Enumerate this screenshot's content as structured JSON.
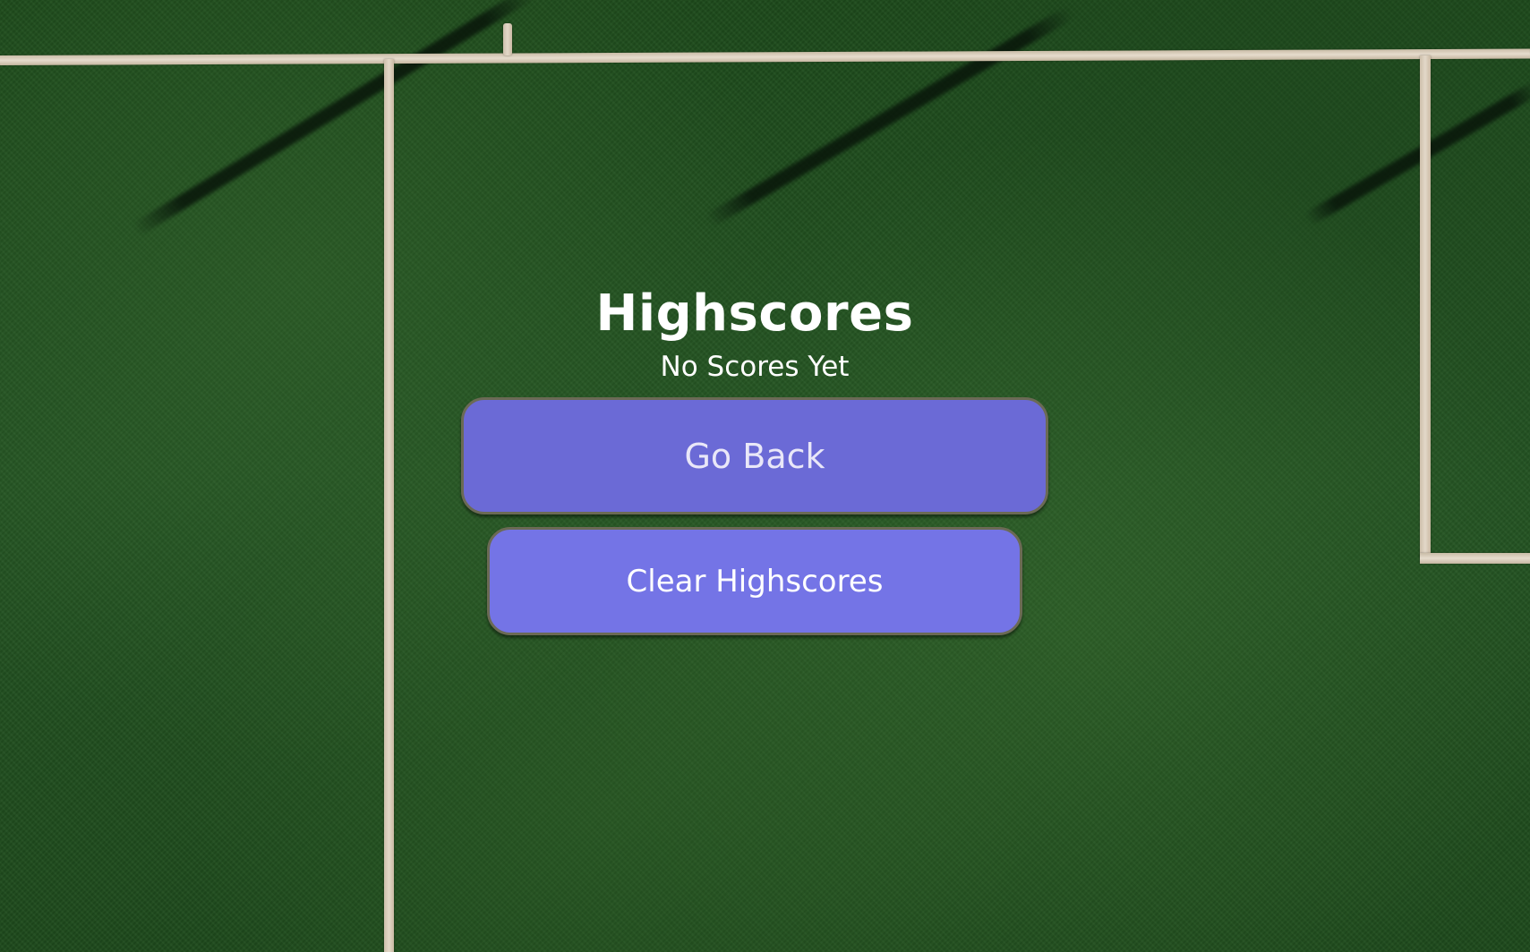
{
  "screen": {
    "title": "Highscores",
    "status_text": "No Scores Yet"
  },
  "actions": {
    "go_back_label": "Go Back",
    "clear_label": "Clear Highscores"
  },
  "colors": {
    "go_back_button": "#6b6ad6",
    "clear_button": "#7474e6",
    "background": "#1f4a1c",
    "text": "#ffffff"
  }
}
